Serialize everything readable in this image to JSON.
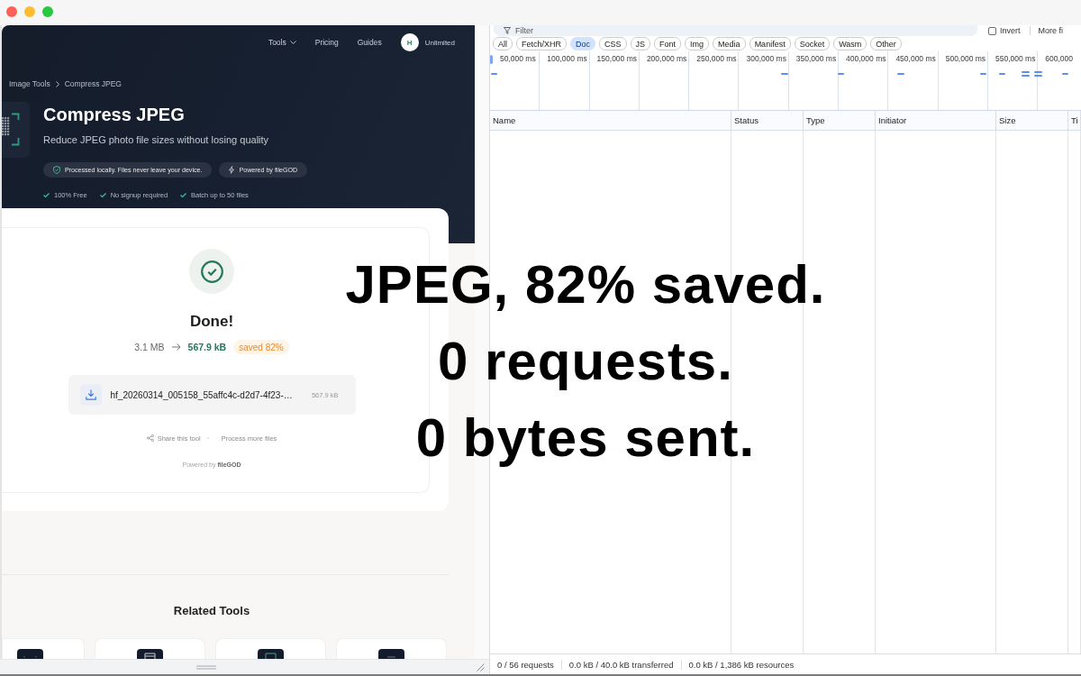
{
  "page": {
    "nav": {
      "items": [
        {
          "label": "Tools",
          "kind": "dropdown"
        },
        {
          "label": "Pricing",
          "kind": "link"
        },
        {
          "label": "Guides",
          "kind": "link"
        }
      ],
      "account": {
        "initial": "H",
        "plan": "Unlimited"
      }
    },
    "breadcrumb": [
      "Image Tools",
      "Compress JPEG"
    ],
    "hero": {
      "title": "Compress JPEG",
      "subtitle": "Reduce JPEG photo file sizes without losing quality",
      "badges": [
        {
          "label": "Processed locally. Files never leave your device.",
          "kind": "shield"
        },
        {
          "label": "Powered by fileGOD",
          "kind": "bolt"
        }
      ],
      "perks": [
        "100% Free",
        "No signup required",
        "Batch up to 50 files"
      ]
    },
    "result": {
      "title": "Done!",
      "original_size": "3.1 MB",
      "compressed_size": "567.9 kB",
      "savings": "saved 82%",
      "file": {
        "name": "hf_20260314_005158_55affc4c-d2d7-4f23-…",
        "size": "567.9 kB"
      },
      "actions": [
        {
          "label": "Share this tool",
          "kind": "share"
        },
        {
          "label": "Process more files",
          "kind": "plain"
        }
      ],
      "footer": "Powered by **fileGOD**"
    },
    "related": {
      "title": "Related Tools"
    }
  },
  "overlay": [
    "JPEG, 82% saved.",
    "0 requests.",
    "0 bytes sent."
  ],
  "devtools": {
    "filter": {
      "placeholder": "Filter"
    },
    "invert": {
      "label": "Invert",
      "checked": false
    },
    "more_filters": "More fi",
    "type_filters": [
      {
        "label": "All",
        "selected": false
      },
      {
        "label": "Fetch/XHR",
        "selected": false
      },
      {
        "label": "Doc",
        "selected": true
      },
      {
        "label": "CSS",
        "selected": false
      },
      {
        "label": "JS",
        "selected": false
      },
      {
        "label": "Font",
        "selected": false
      },
      {
        "label": "Img",
        "selected": false
      },
      {
        "label": "Media",
        "selected": false
      },
      {
        "label": "Manifest",
        "selected": false
      },
      {
        "label": "Socket",
        "selected": false
      },
      {
        "label": "Wasm",
        "selected": false
      },
      {
        "label": "Other",
        "selected": false
      }
    ],
    "timeline": {
      "ticks": [
        "50,000 ms",
        "100,000 ms",
        "150,000 ms",
        "200,000 ms",
        "250,000 ms",
        "300,000 ms",
        "350,000 ms",
        "400,000 ms",
        "450,000 ms",
        "500,000 ms",
        "550,000 ms",
        "600,000"
      ]
    },
    "table": {
      "columns": [
        "Name",
        "Status",
        "Type",
        "Initiator",
        "Size",
        "Ti"
      ]
    },
    "status_bar": [
      "0 / 56 requests",
      "0.0 kB / 40.0 kB transferred",
      "0.0 kB / 1,386 kB resources"
    ]
  }
}
